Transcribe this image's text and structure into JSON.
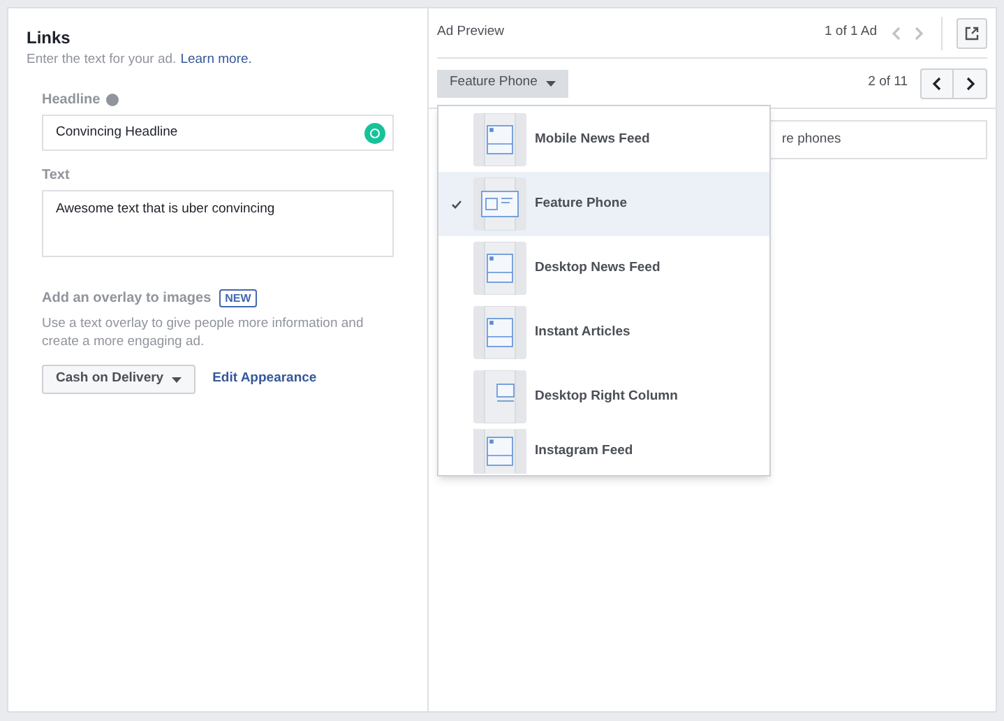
{
  "links": {
    "title": "Links",
    "subtitle": "Enter the text for your ad.",
    "learn_more": "Learn more.",
    "headline": {
      "label": "Headline",
      "value": "Convincing Headline"
    },
    "text": {
      "label": "Text",
      "value": "Awesome text that is uber convincing"
    },
    "overlay": {
      "label": "Add an overlay to images",
      "badge": "NEW",
      "description": "Use a text overlay to give people more information and create a more engaging ad.",
      "dropdown": "Cash on Delivery",
      "edit": "Edit Appearance"
    }
  },
  "preview": {
    "title": "Ad Preview",
    "ad_count": "1 of 1 Ad",
    "placement": "Feature Phone",
    "placement_count": "2 of 11",
    "field_text": "re phones",
    "menu": [
      {
        "label": "Mobile News Feed",
        "selected": false
      },
      {
        "label": "Feature Phone",
        "selected": true
      },
      {
        "label": "Desktop News Feed",
        "selected": false
      },
      {
        "label": "Instant Articles",
        "selected": false
      },
      {
        "label": "Desktop Right Column",
        "selected": false
      },
      {
        "label": "Instagram Feed",
        "selected": false
      }
    ]
  }
}
